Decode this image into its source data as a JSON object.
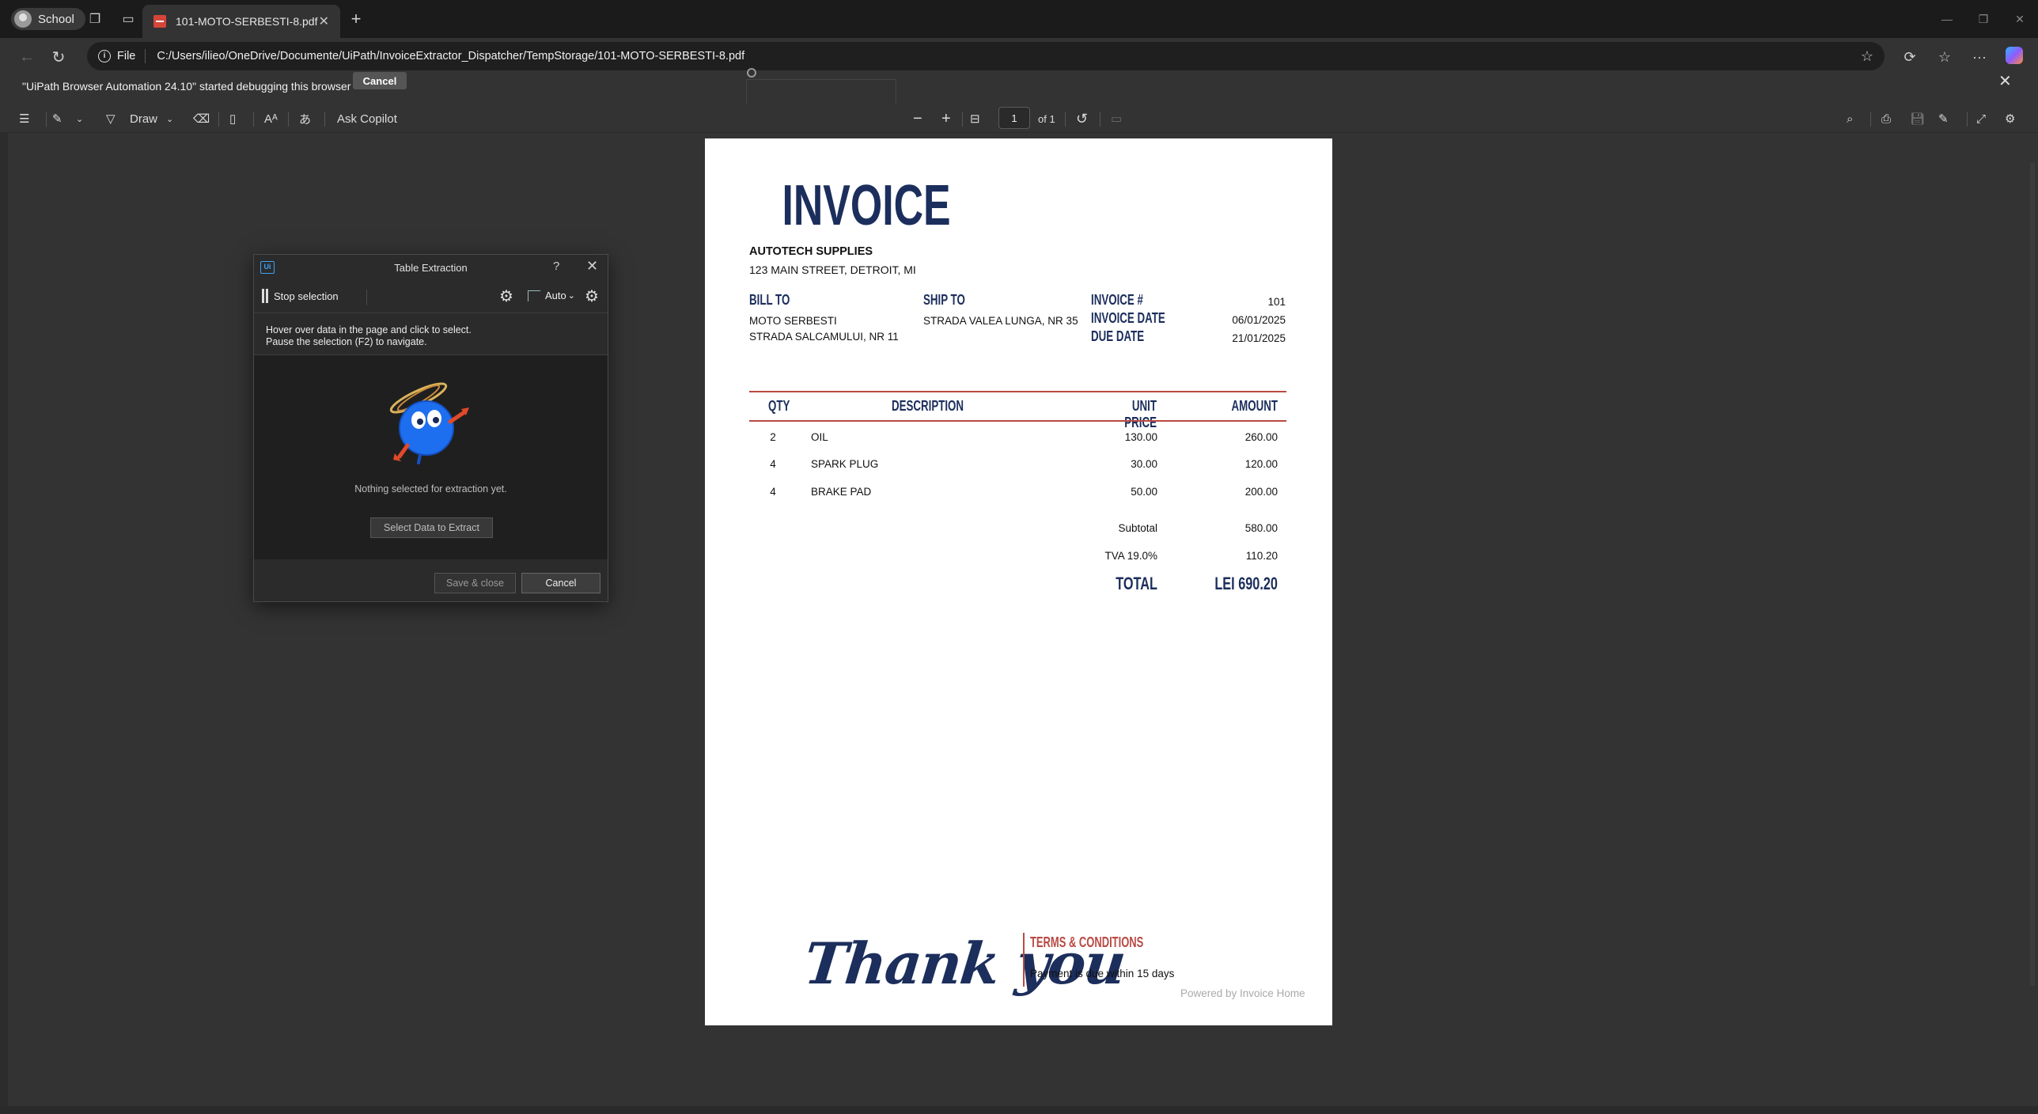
{
  "browser": {
    "profile": "School",
    "tab_title": "101-MOTO-SERBESTI-8.pdf",
    "url_scheme": "File",
    "url": "C:/Users/ilieo/OneDrive/Documente/UiPath/InvoiceExtractor_Dispatcher/TempStorage/101-MOTO-SERBESTI-8.pdf"
  },
  "infobar": {
    "message": "\"UiPath Browser Automation 24.10\" started debugging this browser",
    "cancel_label": "Cancel"
  },
  "pdf_toolbar": {
    "draw_label": "Draw",
    "ask_copilot_label": "Ask Copilot",
    "page_number": "1",
    "page_total": "of 1"
  },
  "invoice": {
    "title": "INVOICE",
    "company": "AUTOTECH SUPPLIES",
    "company_address": "123 MAIN STREET, DETROIT, MI",
    "bill_to_label": "BILL TO",
    "bill_to_name": "MOTO SERBESTI",
    "bill_to_address": "STRADA SALCAMULUI, NR 11",
    "ship_to_label": "SHIP TO",
    "ship_to_address": "STRADA VALEA LUNGA, NR 35",
    "invoice_no_label": "INVOICE #",
    "invoice_no": "101",
    "invoice_date_label": "INVOICE DATE",
    "invoice_date": "06/01/2025",
    "due_date_label": "DUE DATE",
    "due_date": "21/01/2025",
    "columns": [
      "QTY",
      "DESCRIPTION",
      "UNIT PRICE",
      "AMOUNT"
    ],
    "items": [
      {
        "qty": "2",
        "desc": "OIL",
        "price": "130.00",
        "amount": "260.00"
      },
      {
        "qty": "4",
        "desc": "SPARK PLUG",
        "price": "30.00",
        "amount": "120.00"
      },
      {
        "qty": "4",
        "desc": "BRAKE PAD",
        "price": "50.00",
        "amount": "200.00"
      }
    ],
    "subtotal_label": "Subtotal",
    "subtotal": "580.00",
    "tax_label": "TVA 19.0%",
    "tax": "110.20",
    "total_label": "TOTAL",
    "total": "LEI 690.20",
    "thank_you": "Thank you",
    "terms_label": "TERMS & CONDITIONS",
    "terms_text": "Payment is due within 15 days",
    "powered_by": "Powered by Invoice Home"
  },
  "dialog": {
    "title": "Table Extraction",
    "help": "?",
    "stop_selection_label": "Stop selection",
    "mode_label": "Auto",
    "hint_line1": "Hover over data in the page and click to select.",
    "hint_line2": "Pause the selection (F2) to navigate.",
    "empty_message": "Nothing selected for extraction yet.",
    "select_button_label": "Select Data to Extract",
    "save_close_label": "Save & close",
    "cancel_label": "Cancel"
  },
  "colors": {
    "invoice_navy": "#1c2e5c",
    "invoice_red": "#b94a44",
    "uipath_blue": "#3ea2f5"
  }
}
